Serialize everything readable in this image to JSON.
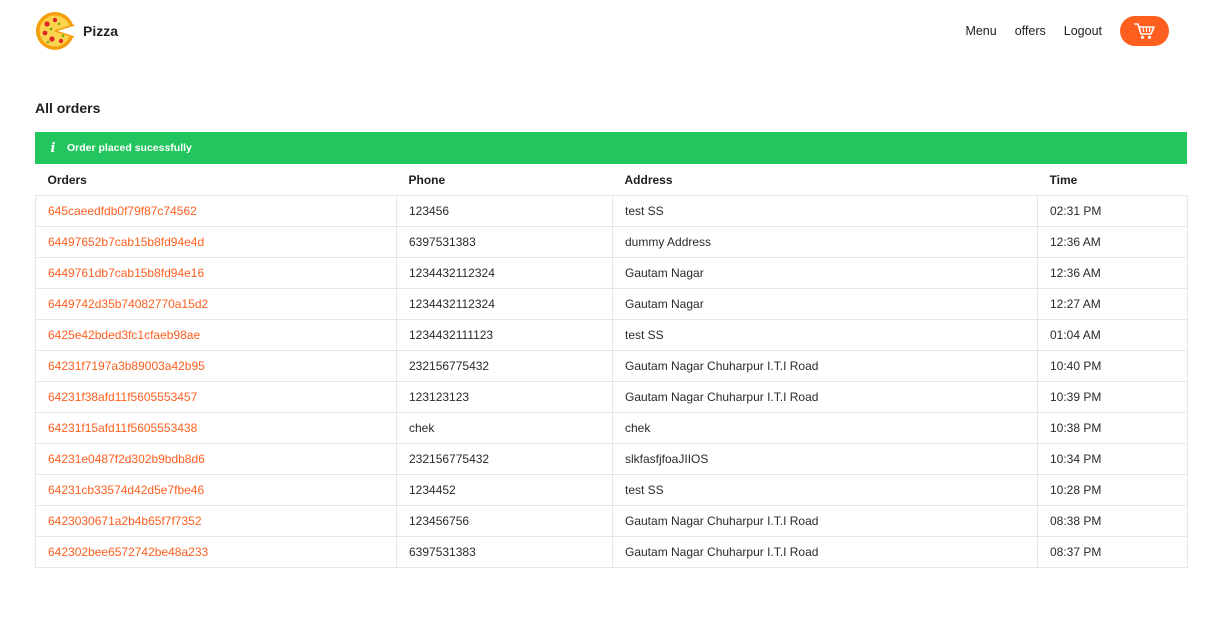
{
  "header": {
    "brand": "Pizza",
    "nav": [
      "Menu",
      "offers",
      "Logout"
    ]
  },
  "page_title": "All orders",
  "alert": {
    "icon": "info-icon",
    "message": "Order placed sucessfully",
    "color": "#22c55e"
  },
  "colors": {
    "accent": "#fe5f1e"
  },
  "table": {
    "columns": [
      "Orders",
      "Phone",
      "Address",
      "Time"
    ],
    "rows": [
      [
        "645caeedfdb0f79f87c74562",
        "123456",
        "test SS",
        "02:31 PM"
      ],
      [
        "64497652b7cab15b8fd94e4d",
        "6397531383",
        "dummy Address",
        "12:36 AM"
      ],
      [
        "6449761db7cab15b8fd94e16",
        "1234432112324",
        "Gautam Nagar",
        "12:36 AM"
      ],
      [
        "6449742d35b74082770a15d2",
        "1234432112324",
        "Gautam Nagar",
        "12:27 AM"
      ],
      [
        "6425e42bded3fc1cfaeb98ae",
        "1234432111123",
        "test SS",
        "01:04 AM"
      ],
      [
        "64231f7197a3b89003a42b95",
        "232156775432",
        "Gautam Nagar Chuharpur I.T.I Road",
        "10:40 PM"
      ],
      [
        "64231f38afd11f5605553457",
        "123123123",
        "Gautam Nagar Chuharpur I.T.I Road",
        "10:39 PM"
      ],
      [
        "64231f15afd11f5605553438",
        "chek",
        "chek",
        "10:38 PM"
      ],
      [
        "64231e0487f2d302b9bdb8d6",
        "232156775432",
        "slkfasfjfoaJIIOS",
        "10:34 PM"
      ],
      [
        "64231cb33574d42d5e7fbe46",
        "1234452",
        "test SS",
        "10:28 PM"
      ],
      [
        "6423030671a2b4b65f7f7352",
        "123456756",
        "Gautam Nagar Chuharpur I.T.I Road",
        "08:38 PM"
      ],
      [
        "642302bee6572742be48a233",
        "6397531383",
        "Gautam Nagar Chuharpur I.T.I Road",
        "08:37 PM"
      ]
    ]
  }
}
